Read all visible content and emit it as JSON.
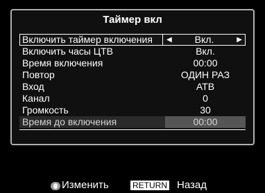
{
  "menu": {
    "title": "Таймер вкл",
    "items": [
      {
        "label": "Включить таймер включения",
        "value": "Вкл."
      },
      {
        "label": "Включить часы ЦТВ",
        "value": "Вкл."
      },
      {
        "label": "Время включения",
        "value": "00:00"
      },
      {
        "label": "Повтор",
        "value": "ОДИН РАЗ"
      },
      {
        "label": "Вход",
        "value": "АТВ"
      },
      {
        "label": "Канал",
        "value": "0"
      },
      {
        "label": "Громкость",
        "value": "30"
      },
      {
        "label": "Время до включения",
        "value": "00:00"
      }
    ]
  },
  "footer": {
    "change_label": "Изменить",
    "return_key": "RETURN",
    "back_label": "Назад"
  },
  "icons": {
    "dpad": "dpad-icon",
    "left_arrow": "left-arrow-icon",
    "right_arrow": "right-arrow-icon"
  }
}
